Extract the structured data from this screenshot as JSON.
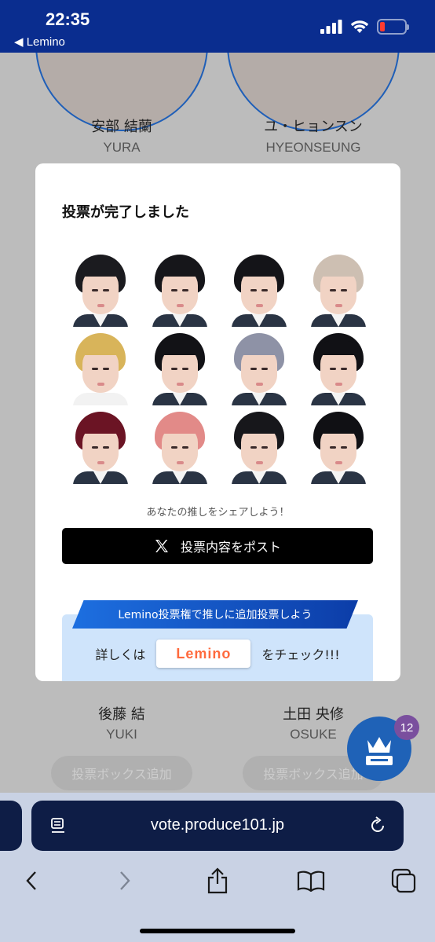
{
  "status_bar": {
    "time": "22:35",
    "back_app": "◀ Lemino"
  },
  "background": {
    "members_top": [
      {
        "name_ja": "安部 結蘭",
        "name_en": "YURA"
      },
      {
        "name_ja": "ユ・ヒョンスン",
        "name_en": "HYEONSEUNG"
      }
    ],
    "members_bottom": [
      {
        "name_ja": "後藤 結",
        "name_en": "YUKI"
      },
      {
        "name_ja": "土田 央修",
        "name_en": "OSUKE"
      }
    ],
    "add_box_label": "投票ボックス追加",
    "fab_badge": "12"
  },
  "modal": {
    "title": "投票が完了しました",
    "share_text": "あなたの推しをシェアしよう！",
    "post_button": "投票内容をポスト",
    "lemino_banner": "Lemino投票権で推しに追加投票しよう",
    "lemino_prefix": "詳しくは",
    "lemino_logo": "Lemino",
    "lemino_suffix": "をチェック!!!"
  },
  "browser": {
    "url": "vote.produce101.jp"
  },
  "colors": {
    "status_bar": "#0a2d8f",
    "post_button": "#000000",
    "lemino_box": "#cfe4fb",
    "url_bar": "#0e1d46"
  }
}
